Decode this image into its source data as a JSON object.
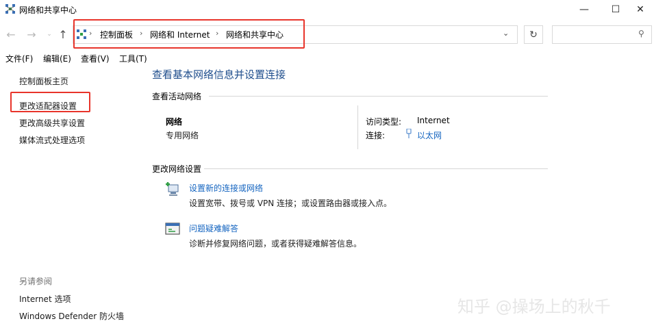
{
  "window": {
    "title": "网络和共享中心",
    "min_glyph": "—",
    "max_glyph": "☐",
    "close_glyph": "✕"
  },
  "nav": {
    "back_glyph": "←",
    "forward_glyph": "→",
    "recent_glyph": "⌄",
    "up_glyph": "↑"
  },
  "address": {
    "crumbs": [
      "控制面板",
      "网络和 Internet",
      "网络和共享中心"
    ],
    "separator": "›",
    "dropdown_glyph": "⌄",
    "refresh_glyph": "↻",
    "search_placeholder": "",
    "search_glyph": "⚲"
  },
  "menu": [
    "文件(F)",
    "编辑(E)",
    "查看(V)",
    "工具(T)"
  ],
  "sidebar": {
    "links": [
      "控制面板主页",
      "更改适配器设置",
      "更改高级共享设置",
      "媒体流式处理选项"
    ],
    "see_also_title": "另请参阅",
    "see_also": [
      "Internet 选项",
      "Windows Defender 防火墙"
    ]
  },
  "main": {
    "title": "查看基本网络信息并设置连接",
    "active_section": "查看活动网络",
    "network": {
      "name": "网络",
      "profile": "专用网络",
      "access_label": "访问类型:",
      "access_value": "Internet",
      "conn_label": "连接:",
      "conn_value": "以太网"
    },
    "change_section": "更改网络设置",
    "tasks": [
      {
        "link": "设置新的连接或网络",
        "desc": "设置宽带、拨号或 VPN 连接；或设置路由器或接入点。"
      },
      {
        "link": "问题疑难解答",
        "desc": "诊断并修复网络问题，或者获得疑难解答信息。"
      }
    ]
  },
  "watermark": "知乎 @操场上的秋千",
  "colors": {
    "highlight": "#e8342a",
    "link": "#1565c0",
    "title": "#1e4d8c"
  }
}
